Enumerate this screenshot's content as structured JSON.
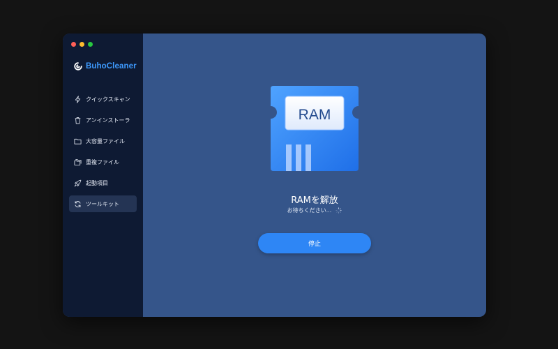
{
  "app": {
    "name": "BuhoCleaner",
    "brand_color": "#3e9bff"
  },
  "window_controls": [
    "close",
    "minimize",
    "zoom"
  ],
  "sidebar": {
    "items": [
      {
        "label": "クイックスキャン",
        "icon": "lightning-icon",
        "active": false
      },
      {
        "label": "アンインストーラ",
        "icon": "trash-icon",
        "active": false
      },
      {
        "label": "大容量ファイル",
        "icon": "folder-icon",
        "active": false
      },
      {
        "label": "重複ファイル",
        "icon": "folders-icon",
        "active": false
      },
      {
        "label": "起動項目",
        "icon": "rocket-icon",
        "active": false
      },
      {
        "label": "ツールキット",
        "icon": "refresh-icon",
        "active": true
      }
    ]
  },
  "main": {
    "chip_label": "RAM",
    "title": "RAMを解放",
    "subtitle": "お待ちください...",
    "stop_button": "停止",
    "accent": "#2e86f5",
    "background": "#35558a"
  }
}
